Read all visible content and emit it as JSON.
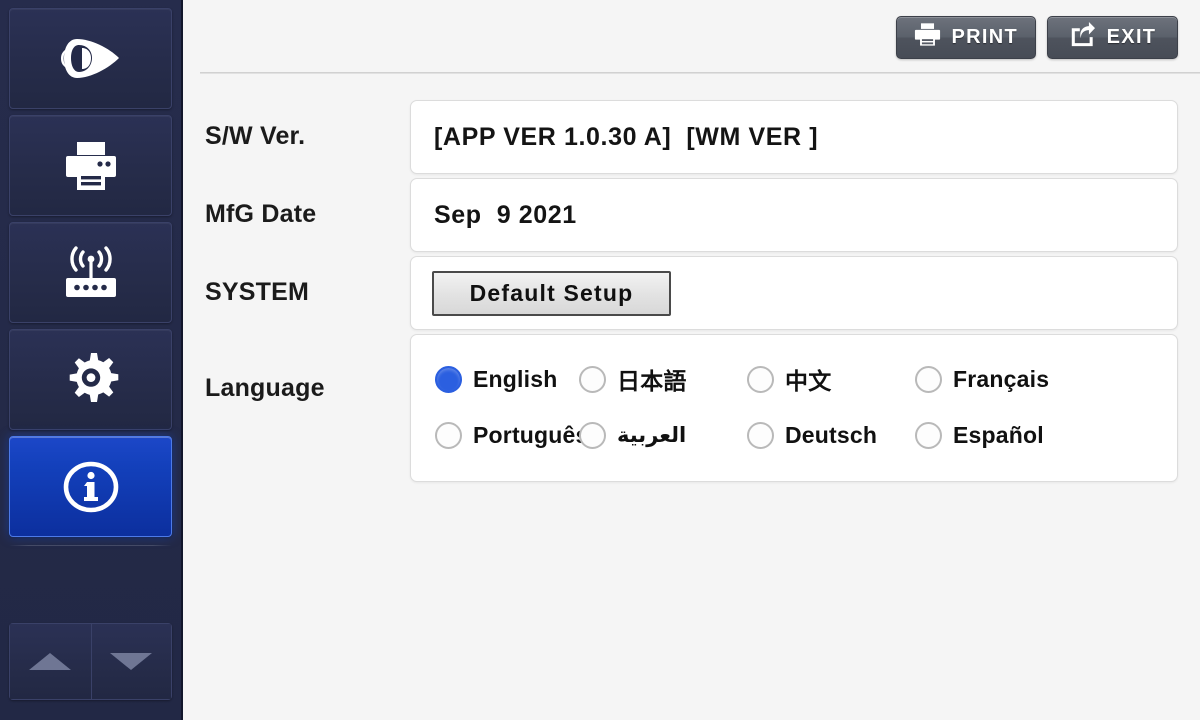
{
  "sidebar": {
    "items": [
      {
        "icon": "eye-viewer-icon",
        "name": "sidebar-item-viewer",
        "active": false
      },
      {
        "icon": "printer-icon",
        "name": "sidebar-item-print",
        "active": false
      },
      {
        "icon": "router-wireless-icon",
        "name": "sidebar-item-network",
        "active": false
      },
      {
        "icon": "gear-icon",
        "name": "sidebar-item-settings",
        "active": false
      },
      {
        "icon": "info-circle-icon",
        "name": "sidebar-item-info",
        "active": true
      }
    ],
    "scroll_up_icon": "triangle-up-icon",
    "scroll_down_icon": "triangle-down-icon"
  },
  "toolbar": {
    "print_label": "PRINT",
    "print_icon": "printer-icon",
    "exit_label": "EXIT",
    "exit_icon": "share-export-icon"
  },
  "form": {
    "rows": [
      {
        "label": "S/W Ver.",
        "value": "[APP VER 1.0.30 A]  [WM VER ]"
      },
      {
        "label": "MfG Date",
        "value": "Sep  9 2021"
      },
      {
        "label": "SYSTEM",
        "button_label": "Default Setup"
      },
      {
        "label": "Language"
      }
    ],
    "sw_ver_label": "S/W Ver.",
    "sw_ver_value": "[APP VER 1.0.30 A]  [WM VER ]",
    "mfg_date_label": "MfG Date",
    "mfg_date_value": "Sep  9 2021",
    "system_label": "SYSTEM",
    "default_setup_label": "Default Setup",
    "language_label": "Language"
  },
  "language": {
    "selected": "English",
    "options": [
      {
        "label": "English",
        "selected": true,
        "script": "latin"
      },
      {
        "label": "日本語",
        "selected": false,
        "script": "cjk"
      },
      {
        "label": "中文",
        "selected": false,
        "script": "cjk"
      },
      {
        "label": "Français",
        "selected": false,
        "script": "latin"
      },
      {
        "label": "Português",
        "selected": false,
        "script": "latin"
      },
      {
        "label": "العربية",
        "selected": false,
        "script": "rtl"
      },
      {
        "label": "Deutsch",
        "selected": false,
        "script": "latin"
      },
      {
        "label": "Español",
        "selected": false,
        "script": "latin"
      }
    ]
  },
  "colors": {
    "sidebar_bg": "#242a48",
    "sidebar_active": "#1340bb",
    "page_bg": "#f5f5f5",
    "toolbar_btn": "#5b616b",
    "radio_selected": "#2b5fe0",
    "text_primary": "#141414"
  }
}
